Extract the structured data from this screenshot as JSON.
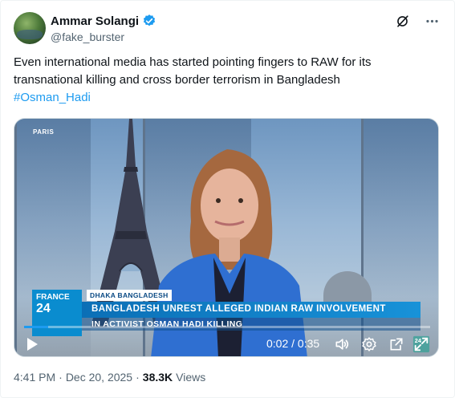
{
  "author": {
    "name": "Ammar Solangi",
    "handle": "@fake_burster"
  },
  "tweet": {
    "text": "Even international media has started pointing fingers to RAW for its transnational killing and cross border terrorism in Bangladesh",
    "hashtag": "#Osman_Hadi"
  },
  "video": {
    "location_label": "PARIS",
    "channel_line1": "FRANCE",
    "channel_line2": "24",
    "dateline": "DHAKA BANGLADESH",
    "headline": "BANGLADESH UNREST ALLEGED INDIAN RAW INVOLVEMENT",
    "subheadline": "IN ACTIVIST OSMAN HADI KILLING",
    "current_time": "0:02",
    "duration": "0:35",
    "time_display": "0:02 / 0:35",
    "progress": 0.06,
    "badge_text": "24"
  },
  "meta": {
    "time": "4:41 PM",
    "separator": "·",
    "date": "Dec 20, 2025",
    "views_count": "38.3K",
    "views_label": "Views"
  },
  "colors": {
    "accent": "#1d9bf0",
    "text": "#0f1419",
    "muted": "#536471",
    "f24_blue": "#0a8ccf"
  },
  "icons": [
    "verified-badge-icon",
    "grok-icon",
    "more-icon",
    "play-icon",
    "volume-icon",
    "settings-icon",
    "popout-icon",
    "expand-icon"
  ]
}
